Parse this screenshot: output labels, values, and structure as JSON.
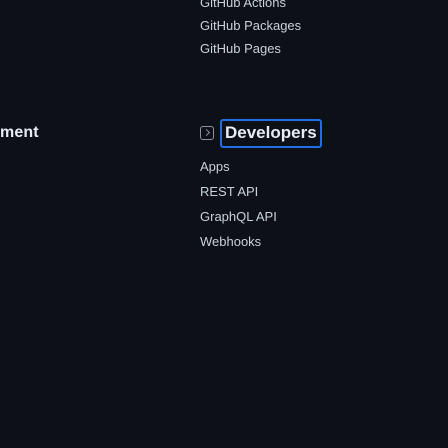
{
  "left": {
    "heading": "ment"
  },
  "top_links": [
    {
      "label": "GitHub Actions"
    },
    {
      "label": "GitHub Packages"
    },
    {
      "label": "GitHub Pages"
    }
  ],
  "developers": {
    "title": "Developers",
    "icon": "terminal-icon",
    "items": [
      {
        "label": "Apps"
      },
      {
        "label": "REST API"
      },
      {
        "label": "GraphQL API"
      },
      {
        "label": "Webhooks"
      }
    ]
  },
  "colors": {
    "background": "#0d1117",
    "text": "#c9d1d9",
    "heading": "#e6edf3",
    "focus_outline": "#1f6feb"
  }
}
